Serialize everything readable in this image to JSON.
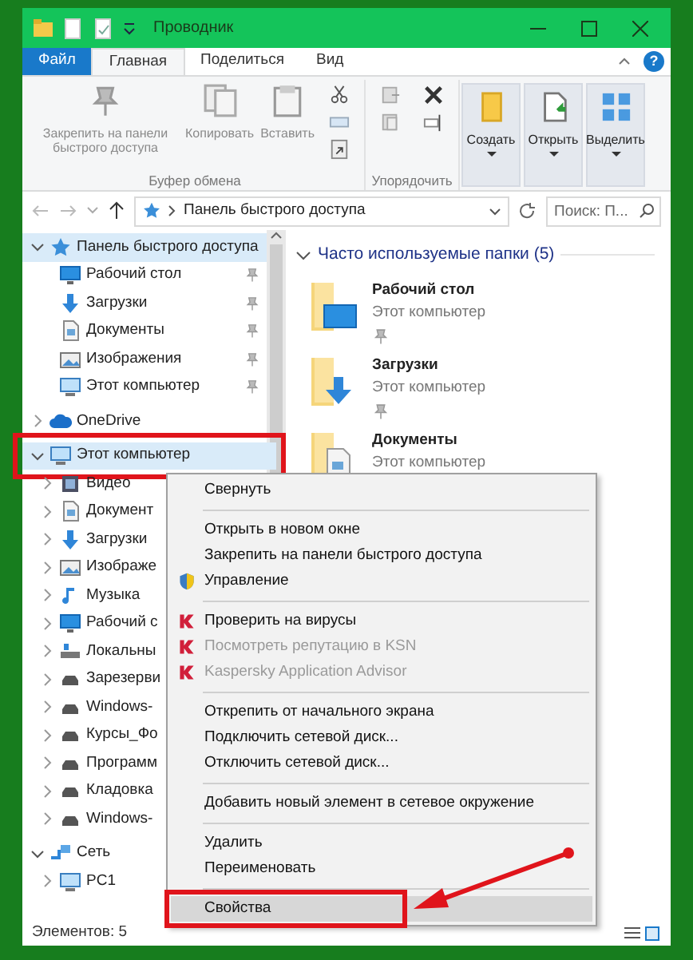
{
  "window": {
    "title": "Проводник"
  },
  "ribbon_tabs": [
    {
      "label": "Файл",
      "kind": "file",
      "selected": false
    },
    {
      "label": "Главная",
      "kind": "tab",
      "selected": true
    },
    {
      "label": "Поделиться",
      "kind": "tab",
      "selected": false
    },
    {
      "label": "Вид",
      "kind": "tab",
      "selected": false
    }
  ],
  "help_button": "?",
  "ribbon_groups": [
    {
      "label": "Буфер обмена",
      "buttons": [
        {
          "label": "Закрепить на панели быстрого доступа",
          "kind": "pin",
          "disabled": true
        },
        {
          "label": "Копировать",
          "kind": "copy",
          "disabled": true
        },
        {
          "label": "Вставить",
          "kind": "paste",
          "disabled": true
        }
      ]
    },
    {
      "label": "Упорядочить"
    }
  ],
  "ribbon_buttons": [
    {
      "label": "Создать",
      "kind": "folder"
    },
    {
      "label": "Открыть",
      "kind": "open"
    },
    {
      "label": "Выделить",
      "kind": "select"
    }
  ],
  "address_bar": {
    "path": "Панель быстрого доступа"
  },
  "search": {
    "placeholder": "Поиск: П..."
  },
  "sidebar": {
    "items": [
      {
        "label": "Панель быстрого доступа",
        "kind": "star",
        "expanded": true,
        "selected": true,
        "highlighted": false,
        "children": [
          {
            "label": "Рабочий стол",
            "kind": "desktop",
            "pinned": true
          },
          {
            "label": "Загрузки",
            "kind": "download",
            "pinned": true
          },
          {
            "label": "Документы",
            "kind": "document",
            "pinned": true
          },
          {
            "label": "Изображения",
            "kind": "image",
            "pinned": true
          },
          {
            "label": "Этот компьютер",
            "kind": "computer",
            "pinned": true
          }
        ]
      },
      {
        "label": "OneDrive",
        "kind": "cloud",
        "expanded": false,
        "selected": false,
        "highlighted": false
      },
      {
        "label": "Этот компьютер",
        "kind": "computer",
        "expanded": true,
        "selected": true,
        "highlighted": true,
        "children": [
          {
            "label": "Видео",
            "kind": "video",
            "expanded": false
          },
          {
            "label": "Документ",
            "kind": "document",
            "expanded": false
          },
          {
            "label": "Загрузки",
            "kind": "download",
            "expanded": false
          },
          {
            "label": "Изображе",
            "kind": "image",
            "expanded": false
          },
          {
            "label": "Музыка",
            "kind": "music",
            "expanded": false
          },
          {
            "label": "Рабочий с",
            "kind": "desktop",
            "expanded": false
          },
          {
            "label": "Локальны",
            "kind": "localdisk",
            "expanded": false
          },
          {
            "label": "Зарезерви",
            "kind": "drive",
            "expanded": false
          },
          {
            "label": "Windows-",
            "kind": "drive",
            "expanded": false
          },
          {
            "label": "Курсы_Фо",
            "kind": "drive",
            "expanded": false
          },
          {
            "label": "Программ",
            "kind": "drive",
            "expanded": false
          },
          {
            "label": "Кладовка",
            "kind": "drive",
            "expanded": false
          },
          {
            "label": "Windows-",
            "kind": "drive",
            "expanded": false
          }
        ]
      },
      {
        "label": "Сеть",
        "kind": "network",
        "expanded": true,
        "selected": false,
        "highlighted": false,
        "children": [
          {
            "label": "PC1",
            "kind": "computer",
            "expanded": false
          }
        ]
      }
    ]
  },
  "main": {
    "section_title": "Часто используемые папки (5)",
    "expanded": true,
    "folders": [
      {
        "name": "Рабочий стол",
        "location": "Этот компьютер",
        "kind": "desktop",
        "pinned": true
      },
      {
        "name": "Загрузки",
        "location": "Этот компьютер",
        "kind": "download",
        "pinned": true
      },
      {
        "name": "Документы",
        "location": "Этот компьютер",
        "kind": "document",
        "pinned": false
      }
    ]
  },
  "context_menu": {
    "items": [
      {
        "kind": "item",
        "label": "Свернуть",
        "disabled": false,
        "selected": false,
        "highlighted": false
      },
      {
        "kind": "separator"
      },
      {
        "kind": "item",
        "label": "Открыть в новом окне",
        "disabled": false,
        "selected": false,
        "highlighted": false
      },
      {
        "kind": "item",
        "label": "Закрепить на панели быстрого доступа",
        "disabled": false,
        "selected": false,
        "highlighted": false
      },
      {
        "kind": "admin",
        "label": "Управление",
        "disabled": false,
        "selected": false,
        "highlighted": false
      },
      {
        "kind": "separator"
      },
      {
        "kind": "antivirus",
        "label": "Проверить на вирусы",
        "disabled": false,
        "selected": false,
        "highlighted": false
      },
      {
        "kind": "antivirus",
        "label": "Посмотреть репутацию в KSN",
        "disabled": true,
        "selected": false,
        "highlighted": false
      },
      {
        "kind": "antivirus",
        "label": "Kaspersky Application Advisor",
        "disabled": true,
        "selected": false,
        "highlighted": false
      },
      {
        "kind": "separator"
      },
      {
        "kind": "item",
        "label": "Открепить от начального экрана",
        "disabled": false,
        "selected": false,
        "highlighted": false
      },
      {
        "kind": "item",
        "label": "Подключить сетевой диск...",
        "disabled": false,
        "selected": false,
        "highlighted": false
      },
      {
        "kind": "item",
        "label": "Отключить сетевой диск...",
        "disabled": false,
        "selected": false,
        "highlighted": false
      },
      {
        "kind": "separator"
      },
      {
        "kind": "item",
        "label": "Добавить новый элемент в сетевое окружение",
        "disabled": false,
        "selected": false,
        "highlighted": false
      },
      {
        "kind": "separator"
      },
      {
        "kind": "item",
        "label": "Удалить",
        "disabled": false,
        "selected": false,
        "highlighted": false
      },
      {
        "kind": "item",
        "label": "Переименовать",
        "disabled": false,
        "selected": false,
        "highlighted": false
      },
      {
        "kind": "separator"
      },
      {
        "kind": "item",
        "label": "Свойства",
        "disabled": false,
        "selected": true,
        "highlighted": true
      }
    ]
  },
  "status_bar": {
    "text": "Элементов: 5"
  }
}
